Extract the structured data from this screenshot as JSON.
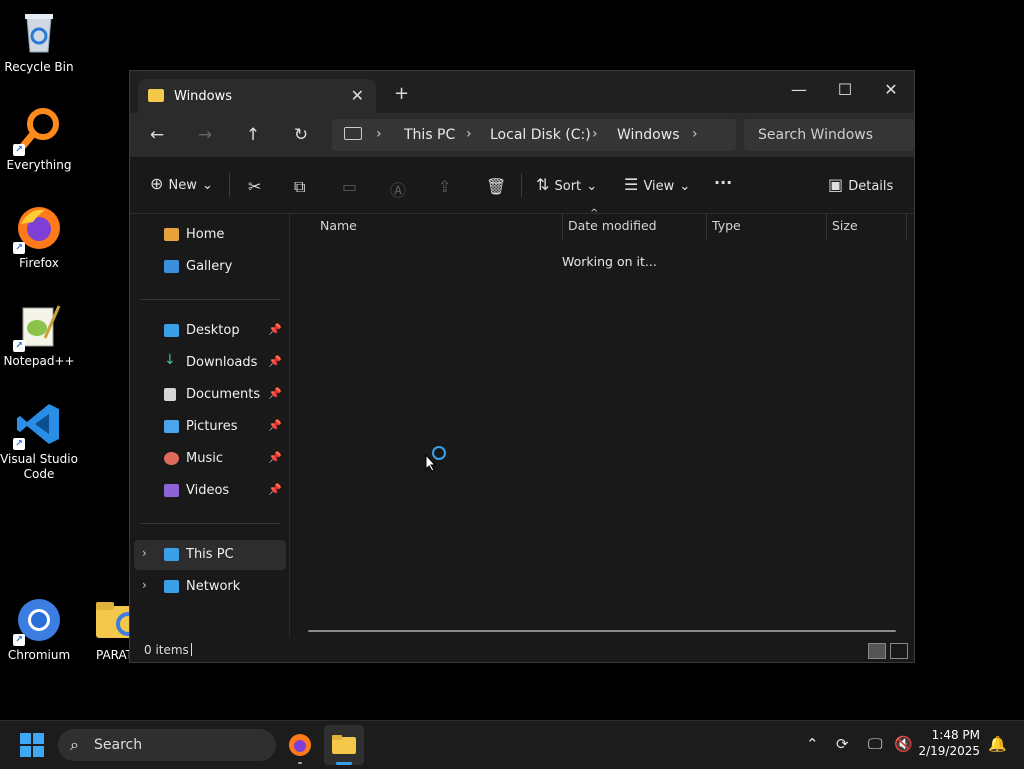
{
  "desktop": {
    "icons": [
      {
        "label": "Recycle Bin"
      },
      {
        "label": "Everything"
      },
      {
        "label": "Firefox"
      },
      {
        "label": "Notepad++"
      },
      {
        "label": "Visual Studio Code"
      },
      {
        "label": "Chromium"
      },
      {
        "label": "PARAT"
      }
    ]
  },
  "window": {
    "tab_title": "Windows",
    "new_tab": "+",
    "controls": {
      "minimize": "—",
      "maximize": "☐",
      "close": "✕"
    },
    "breadcrumb": [
      "This PC",
      "Local Disk (C:)",
      "Windows"
    ],
    "search_placeholder": "Search Windows",
    "toolbar": {
      "new_label": "New",
      "sort_label": "Sort",
      "view_label": "View",
      "details_label": "Details",
      "more": "···"
    },
    "sidebar": {
      "quick": [
        {
          "label": "Home",
          "color": "#e8a33d"
        },
        {
          "label": "Gallery",
          "color": "#3b8fdc"
        }
      ],
      "pinned": [
        {
          "label": "Desktop",
          "color": "#3aa0e8"
        },
        {
          "label": "Downloads",
          "color": "#41c58b"
        },
        {
          "label": "Documents",
          "color": "#d6d6d6"
        },
        {
          "label": "Pictures",
          "color": "#4aa6ea"
        },
        {
          "label": "Music",
          "color": "#e06a5c"
        },
        {
          "label": "Videos",
          "color": "#8e63d8"
        }
      ],
      "tree": [
        {
          "label": "This PC",
          "color": "#3aa0e8"
        },
        {
          "label": "Network",
          "color": "#3aa0e8"
        }
      ]
    },
    "columns": [
      "Name",
      "Date modified",
      "Type",
      "Size"
    ],
    "loading_text": "Working on it...",
    "status": "0 items"
  },
  "taskbar": {
    "search_label": "Search",
    "time": "1:48 PM",
    "date": "2/19/2025"
  }
}
